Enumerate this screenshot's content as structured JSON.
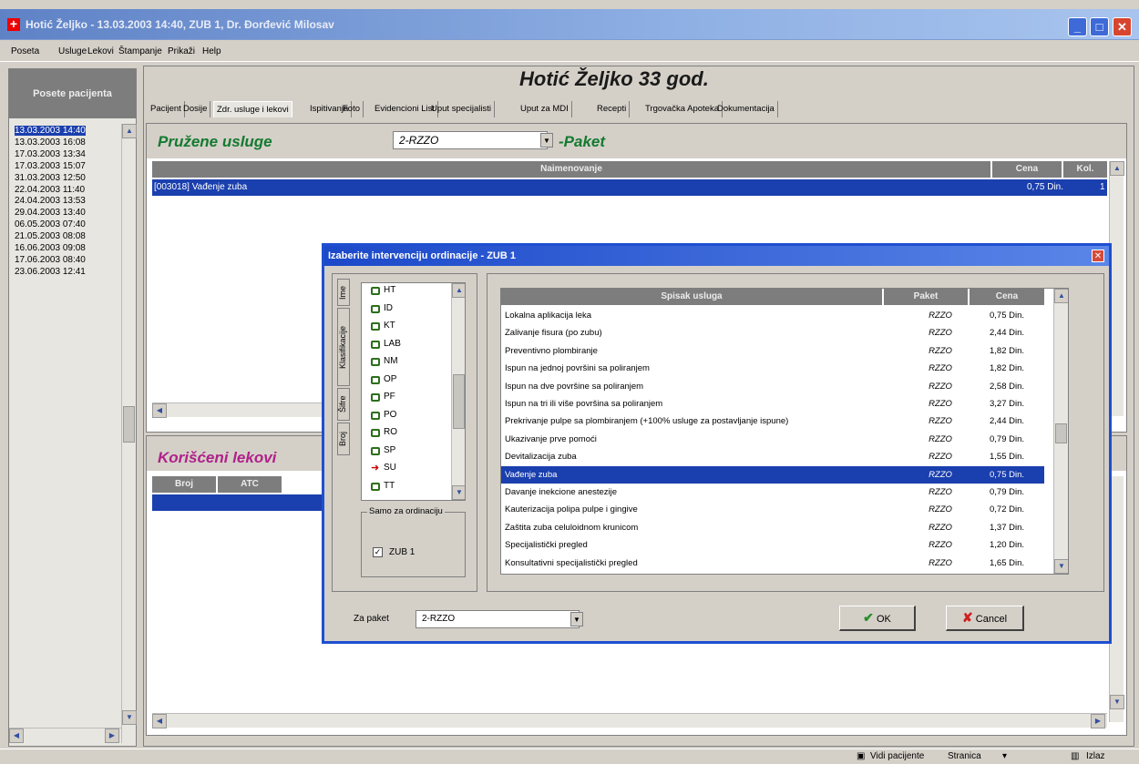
{
  "window": {
    "title": "Hotić Željko - 13.03.2003 14:40, ZUB 1, Dr. Đorđević Milosav",
    "icon": "medical-cross-icon",
    "controls": [
      "minimize-icon",
      "maximize-icon",
      "close-icon"
    ]
  },
  "menu": [
    "Poseta",
    "Usluge",
    "Lekovi",
    "Štampanje",
    "Prikaži",
    "Help"
  ],
  "left_panel": {
    "header": "Posete pacijenta",
    "visits": [
      "13.03.2003 14:40",
      "13.03.2003 16:08",
      "17.03.2003 13:34",
      "17.03.2003 15:07",
      "31.03.2003 12:50",
      "22.04.2003 11:40",
      "24.04.2003 13:53",
      "29.04.2003 13:40",
      "06.05.2003 07:40",
      "21.05.2003 08:08",
      "16.06.2003 09:08",
      "17.06.2003 08:40",
      "23.06.2003 12:41"
    ],
    "selected_index": 0
  },
  "patient": {
    "heading": "Hotić  Željko  33 god."
  },
  "tabs": [
    "Pacijent",
    "Dosije",
    "Zdr. usluge i lekovi",
    "Ispitivanja",
    "Foto",
    "Evidencioni List",
    "Uput specijalisti",
    "Uput za MDI",
    "Recepti",
    "Trgovačka Apoteka",
    "Dokumentacija"
  ],
  "selected_tab": "Zdr. usluge i lekovi",
  "services_section": {
    "title": "Pružene usluge",
    "package_combo": "2-RZZO",
    "package_label": "-Paket",
    "columns": [
      "Naimenovanje",
      "Cena",
      "Kol."
    ],
    "rows": [
      {
        "name": "[003018] Vađenje zuba",
        "price": "0,75 Din.",
        "qty": "1"
      }
    ]
  },
  "drugs_section": {
    "title": "Korišćeni lekovi",
    "columns": [
      "Broj",
      "ATC"
    ]
  },
  "dialog": {
    "title": "Izaberite intervenciju ordinacije - ZUB 1",
    "close": "close-icon",
    "side_tabs": [
      "Ime",
      "Klasifikacije",
      "Šifre",
      "Broj"
    ],
    "tree_items": [
      "HT",
      "ID",
      "KT",
      "LAB",
      "NM",
      "OP",
      "PF",
      "PO",
      "RO",
      "SP",
      "SU",
      "TT"
    ],
    "tree_selected": "SU",
    "filter_group": "Samo za ordinaciju",
    "filter_checkbox": "ZUB 1",
    "filter_checked": true,
    "list_columns": [
      "Spisak usluga",
      "Paket",
      "Cena"
    ],
    "services": [
      {
        "name": "Lokalna aplikacija leka",
        "pkg": "RZZO",
        "price": "0,75 Din."
      },
      {
        "name": "Zalivanje fisura (po zubu)",
        "pkg": "RZZO",
        "price": "2,44 Din."
      },
      {
        "name": "Preventivno plombiranje",
        "pkg": "RZZO",
        "price": "1,82 Din."
      },
      {
        "name": "Ispun na jednoj površini sa poliranjem",
        "pkg": "RZZO",
        "price": "1,82 Din."
      },
      {
        "name": "Ispun na dve površine sa poliranjem",
        "pkg": "RZZO",
        "price": "2,58 Din."
      },
      {
        "name": "Ispun na tri ili više površina sa poliranjem",
        "pkg": "RZZO",
        "price": "3,27 Din."
      },
      {
        "name": "Prekrivanje pulpe sa plombiranjem (+100% usluge za postavljanje ispune)",
        "pkg": "RZZO",
        "price": "2,44 Din."
      },
      {
        "name": "Ukazivanje prve pomoći",
        "pkg": "RZZO",
        "price": "0,79 Din."
      },
      {
        "name": "Devitalizacija zuba",
        "pkg": "RZZO",
        "price": "1,55 Din."
      },
      {
        "name": "Vađenje zuba",
        "pkg": "RZZO",
        "price": "0,75 Din."
      },
      {
        "name": "Davanje inekcione anestezije",
        "pkg": "RZZO",
        "price": "0,79 Din."
      },
      {
        "name": "Kauterizacija polipa pulpe i gingive",
        "pkg": "RZZO",
        "price": "0,72 Din."
      },
      {
        "name": "Zaštita zuba celuloidnom krunicom",
        "pkg": "RZZO",
        "price": "1,37 Din."
      },
      {
        "name": "Specijalistički pregled",
        "pkg": "RZZO",
        "price": "1,20 Din."
      },
      {
        "name": "Konsultativni specijalistički pregled",
        "pkg": "RZZO",
        "price": "1,65 Din."
      }
    ],
    "selected_service_index": 9,
    "package_label": "Za paket",
    "package_value": "2-RZZO",
    "ok_label": "OK",
    "cancel_label": "Cancel"
  },
  "status": {
    "vidi_pacijente": "Vidi pacijente",
    "stranica": "Stranica",
    "izlaz": "Izlaz"
  }
}
